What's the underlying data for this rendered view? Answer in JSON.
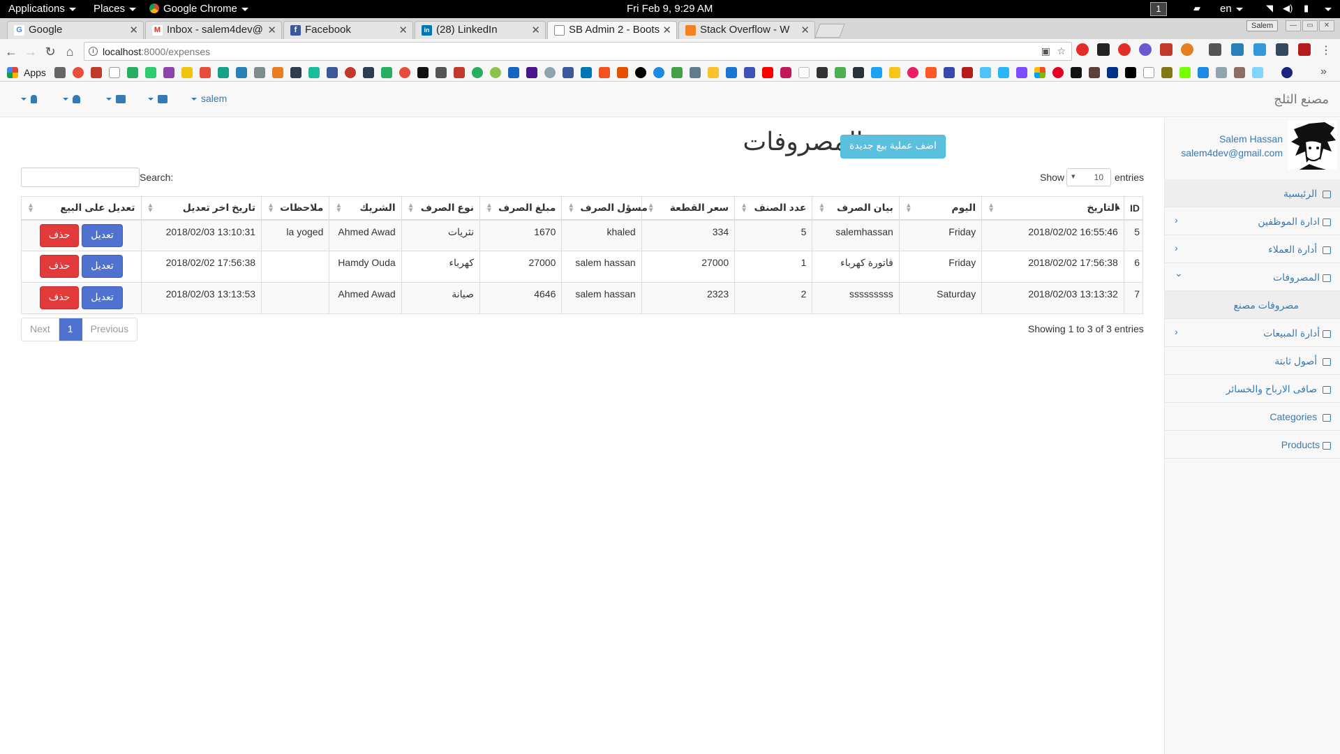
{
  "os_bar": {
    "applications": "Applications",
    "places": "Places",
    "chrome": "Google Chrome",
    "clock": "Fri Feb  9,  9:29 AM",
    "workspace": "1",
    "lang": "en"
  },
  "tabs": [
    {
      "title": "Google",
      "icon_color": "#4285f4",
      "icon_char": "G"
    },
    {
      "title": "Inbox - salem4dev@",
      "icon_color": "#d93025",
      "icon_char": "M"
    },
    {
      "title": "Facebook",
      "icon_color": "#3b5998",
      "icon_char": "f"
    },
    {
      "title": "(28) LinkedIn",
      "icon_color": "#0077b5",
      "icon_char": "in"
    },
    {
      "title": "SB Admin 2 - Boots",
      "icon_color": "#888888",
      "icon_char": ""
    },
    {
      "title": "Stack Overflow - W",
      "icon_color": "#f48024",
      "icon_char": ""
    }
  ],
  "window": {
    "profile": "Salem"
  },
  "omnibox": {
    "host": "localhost",
    "path": ":8000/expenses"
  },
  "bookmarks": {
    "apps_label": "Apps"
  },
  "app": {
    "brand": "مصنع الثلج",
    "user_menu": "salem",
    "profile_name": "Salem Hassan",
    "profile_email": "salem4dev@gmail.com"
  },
  "sidebar": {
    "items": [
      {
        "label": "الرئيسية",
        "icon": "dashboard-icon",
        "has_arrow": false
      },
      {
        "label": "ادارة الموظفين",
        "icon": "bar-chart-icon",
        "has_arrow": true,
        "arrow": "›"
      },
      {
        "label": "أدارة العملاء",
        "icon": "wrench-icon",
        "has_arrow": true,
        "arrow": "›"
      },
      {
        "label": "المصروفات",
        "icon": "sitemap-icon",
        "has_arrow": true,
        "arrow": "⌄"
      },
      {
        "label": "مصروفات مصنع",
        "icon": "",
        "has_arrow": false,
        "sub": true
      },
      {
        "label": "أدارة المبيعات",
        "icon": "copy-icon",
        "has_arrow": true,
        "arrow": "›"
      },
      {
        "label": "أصول ثابتة",
        "icon": "edit-icon",
        "has_arrow": false
      },
      {
        "label": "صافى الارباح والخسائر",
        "icon": "table-icon",
        "has_arrow": false
      },
      {
        "label": "Categories",
        "icon": "edit-icon",
        "has_arrow": false
      },
      {
        "label": "Products",
        "icon": "table-icon",
        "has_arrow": false
      }
    ]
  },
  "content": {
    "title": "صفحة المصروفات",
    "add_button": "اضف عملية بيع جديدة",
    "show_label": "Show",
    "entries_value": "10",
    "entries_label": "entries",
    "search_label": "Search:",
    "search_value": "",
    "info": "Showing 1 to 3 of 3 entries",
    "pager": {
      "next": "Next",
      "current": "1",
      "previous": "Previous"
    }
  },
  "table": {
    "columns": [
      "ID",
      "التاريخ",
      "اليوم",
      "بيان الصرف",
      "عدد الصنف",
      "سعر القطعة",
      "مسؤل الصرف",
      "مبلغ الصرف",
      "نوع الصرف",
      "الشريك",
      "ملاحظات",
      "تاريخ اخر تعديل",
      "تعديل على البيع"
    ],
    "rows": [
      {
        "id": "5",
        "date": "2018/02/02 16:55:46",
        "day": "Friday",
        "desc": "salemhassan",
        "qty": "5",
        "price": "334",
        "officer": "khaled",
        "amount": "1670",
        "type": "نثريات",
        "partner": "Ahmed Awad",
        "notes": "la yoged",
        "modified": "2018/02/03 13:10:31"
      },
      {
        "id": "6",
        "date": "2018/02/02 17:56:38",
        "day": "Friday",
        "desc": "فاتورة كهرباء",
        "qty": "1",
        "price": "27000",
        "officer": "salem hassan",
        "amount": "27000",
        "type": "كهرباء",
        "partner": "Hamdy Ouda",
        "notes": "",
        "modified": "2018/02/02 17:56:38"
      },
      {
        "id": "7",
        "date": "2018/02/03 13:13:32",
        "day": "Saturday",
        "desc": "sssssssss",
        "qty": "2",
        "price": "2323",
        "officer": "salem hassan",
        "amount": "4646",
        "type": "صيانة",
        "partner": "Ahmed Awad",
        "notes": "",
        "modified": "2018/02/03 13:13:53"
      }
    ],
    "edit_label": "تعديل",
    "delete_label": "حذف"
  }
}
